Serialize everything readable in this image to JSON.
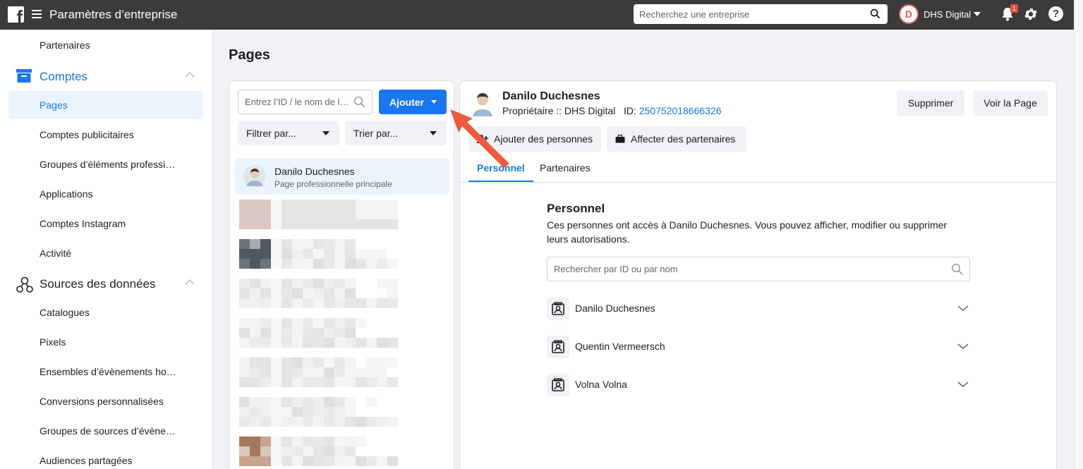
{
  "topbar": {
    "title": "Paramètres d’entreprise",
    "search_placeholder": "Recherchez une entreprise",
    "business_name": "DHS Digital",
    "business_initial": "D",
    "notification_count": "1",
    "help_label": "?"
  },
  "sidebar": {
    "items_top": [
      {
        "label": "Partenaires"
      }
    ],
    "section_accounts": "Comptes",
    "accounts_items": [
      {
        "label": "Pages"
      },
      {
        "label": "Comptes publicitaires"
      },
      {
        "label": "Groupes d’éléments professi…"
      },
      {
        "label": "Applications"
      },
      {
        "label": "Comptes Instagram"
      },
      {
        "label": "Activité"
      }
    ],
    "section_data": "Sources des données",
    "data_items": [
      {
        "label": "Catalogues"
      },
      {
        "label": "Pixels"
      },
      {
        "label": "Ensembles d’évènements ho…"
      },
      {
        "label": "Conversions personnalisées"
      },
      {
        "label": "Groupes de sources d’évène…"
      },
      {
        "label": "Audiences partagées"
      }
    ]
  },
  "main": {
    "page_title": "Pages",
    "left": {
      "search_placeholder": "Entrez l’ID / le nom de l…",
      "add_label": "Ajouter",
      "filter_label": "Filtrer par...",
      "sort_label": "Trier par...",
      "selected_page": {
        "name": "Danilo Duchesnes",
        "subtitle": "Page professionnelle principale"
      }
    },
    "right": {
      "name": "Danilo Duchesnes",
      "owner_text": "Propriétaire :: DHS Digital",
      "id_label": "ID:",
      "id_value": "250752018666326",
      "delete_label": "Supprimer",
      "view_label": "Voir la Page",
      "add_people_label": "Ajouter des personnes",
      "assign_partners_label": "Affecter des partenaires",
      "tabs": [
        {
          "label": "Personnel"
        },
        {
          "label": "Partenaires"
        }
      ],
      "section_title": "Personnel",
      "section_desc": "Ces personnes ont accès à Danilo Duchesnes. Vous pouvez afficher, modifier ou supprimer leurs autorisations.",
      "people_search_placeholder": "Rechercher par ID ou par nom",
      "people": [
        {
          "name": "Danilo Duchesnes"
        },
        {
          "name": "Quentin Vermeersch"
        },
        {
          "name": "Volna Volna"
        }
      ]
    }
  },
  "colors": {
    "accent": "#1876f2",
    "topbar": "#3b3b3b",
    "arrow": "#ee5a3c"
  }
}
